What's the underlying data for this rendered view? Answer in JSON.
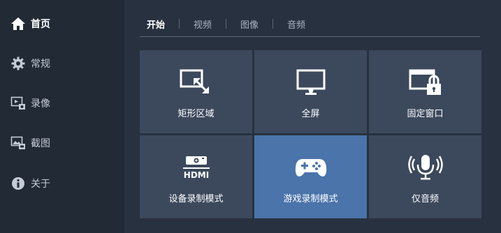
{
  "sidebar": {
    "items": [
      {
        "label": "首页",
        "icon": "home-icon",
        "active": true
      },
      {
        "label": "常规",
        "icon": "gear-icon",
        "active": false
      },
      {
        "label": "录像",
        "icon": "video-record-icon",
        "active": false
      },
      {
        "label": "截图",
        "icon": "screenshot-icon",
        "active": false
      },
      {
        "label": "关于",
        "icon": "info-icon",
        "active": false
      }
    ]
  },
  "tabs": [
    {
      "label": "开始",
      "active": true
    },
    {
      "label": "视频",
      "active": false
    },
    {
      "label": "图像",
      "active": false
    },
    {
      "label": "音频",
      "active": false
    }
  ],
  "tiles": [
    {
      "label": "矩形区域",
      "icon": "rectangle-region-icon",
      "highlighted": false
    },
    {
      "label": "全屏",
      "icon": "monitor-icon",
      "highlighted": false
    },
    {
      "label": "固定窗口",
      "icon": "locked-window-icon",
      "highlighted": false
    },
    {
      "label": "设备录制模式",
      "icon": "hdmi-device-icon",
      "highlighted": false
    },
    {
      "label": "游戏录制模式",
      "icon": "gamepad-icon",
      "highlighted": true
    },
    {
      "label": "仅音频",
      "icon": "microphone-icon",
      "highlighted": false
    }
  ],
  "colors": {
    "sidebar_bg": "#222a36",
    "main_bg": "#283140",
    "tile_bg": "#3c495c",
    "tile_highlight": "#4a74aa"
  }
}
